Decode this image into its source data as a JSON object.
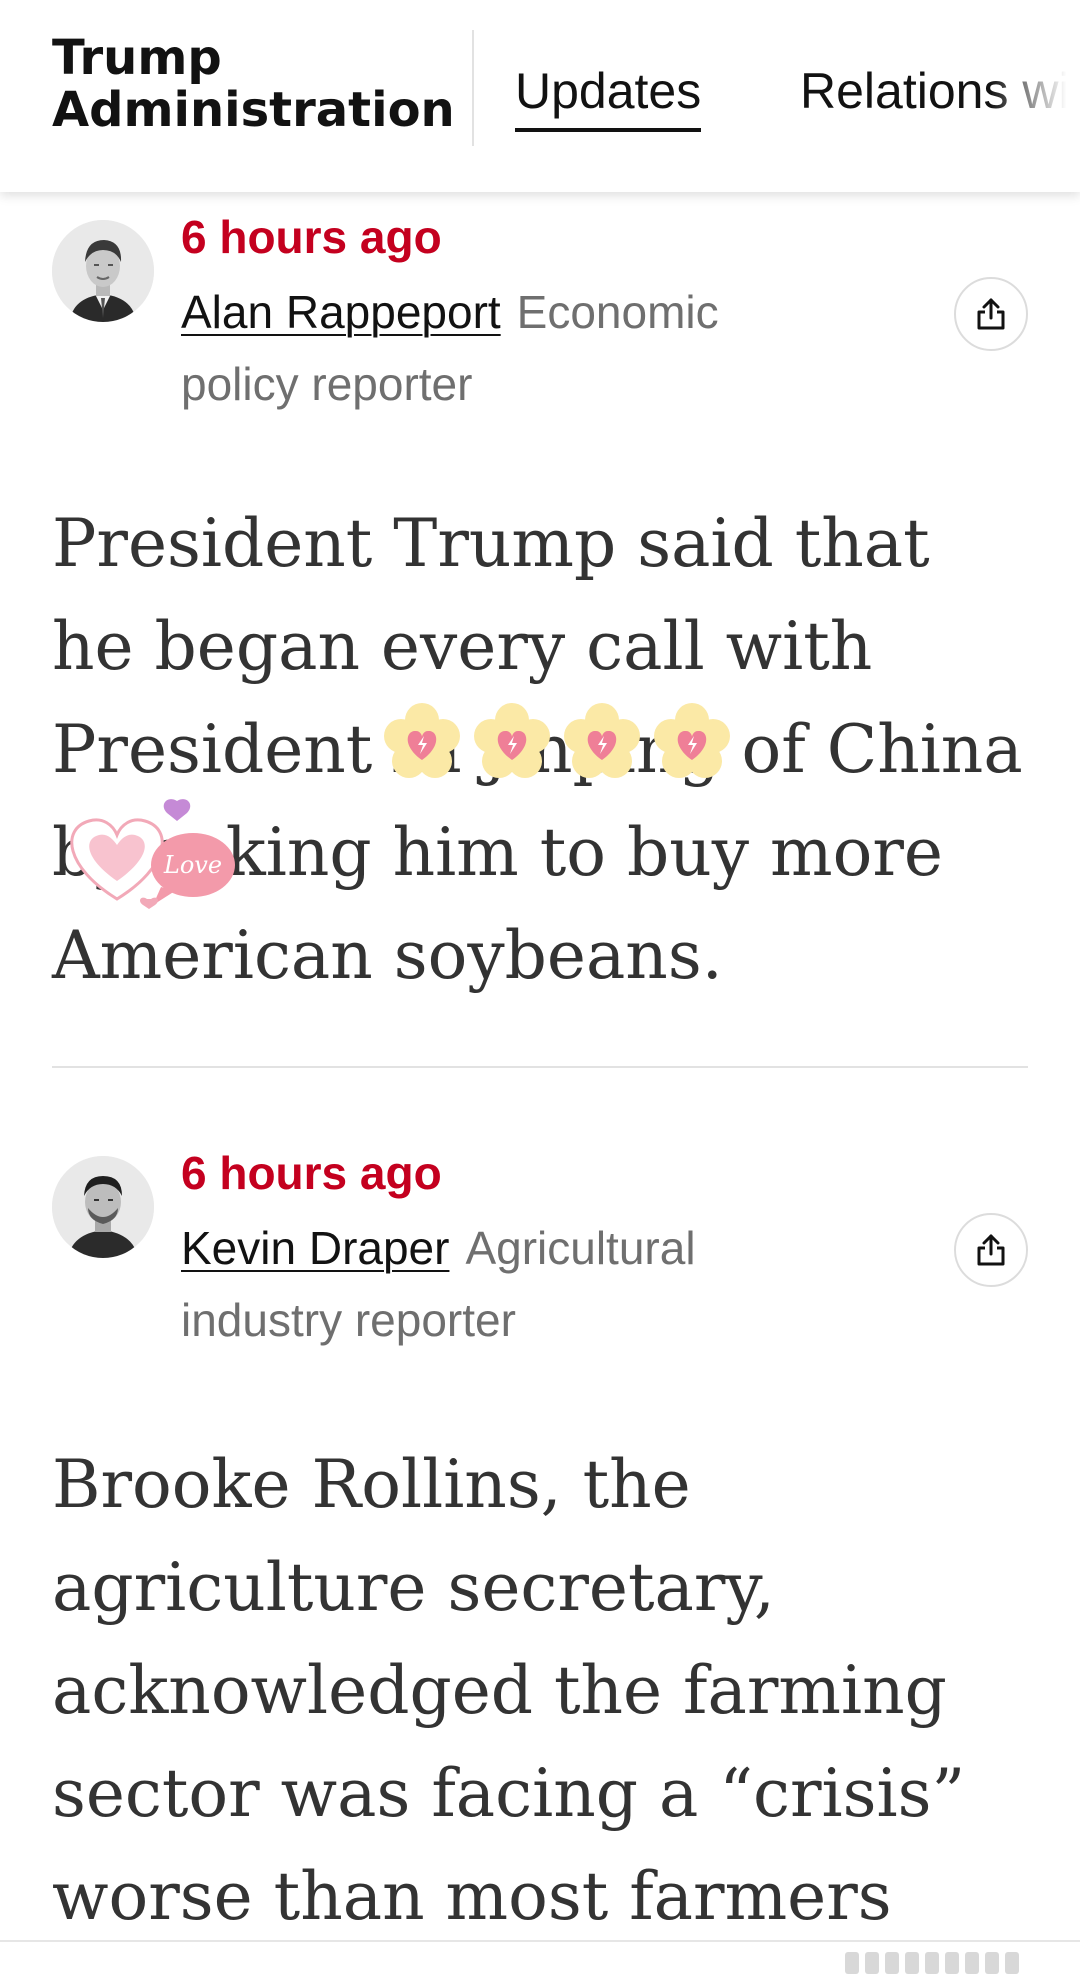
{
  "header": {
    "section_title_line1": "Trump",
    "section_title_line2": "Administration",
    "tabs": [
      {
        "label": "Updates",
        "active": true
      },
      {
        "label": "Relations wi",
        "active": false
      }
    ]
  },
  "entries": [
    {
      "timestamp": "6 hours ago",
      "author": "Alan Rappeport",
      "role": "Economic policy reporter",
      "text": "President Trump said that he began every call with President Xi Jinping of China by asking him to buy more American soybeans."
    },
    {
      "timestamp": "6 hours ago",
      "author": "Kevin Draper",
      "role": "Agricultural industry reporter",
      "text": "Brooke Rollins, the agriculture secretary, acknowledged the farming sector was facing a “crisis” worse than most farmers"
    }
  ],
  "stickers": {
    "love_text": "Love"
  },
  "colors": {
    "timestamp": "#c4001f",
    "text": "#121212",
    "muted": "#6f6f6f",
    "body": "#333333"
  },
  "icons": {
    "share": "share-icon"
  }
}
